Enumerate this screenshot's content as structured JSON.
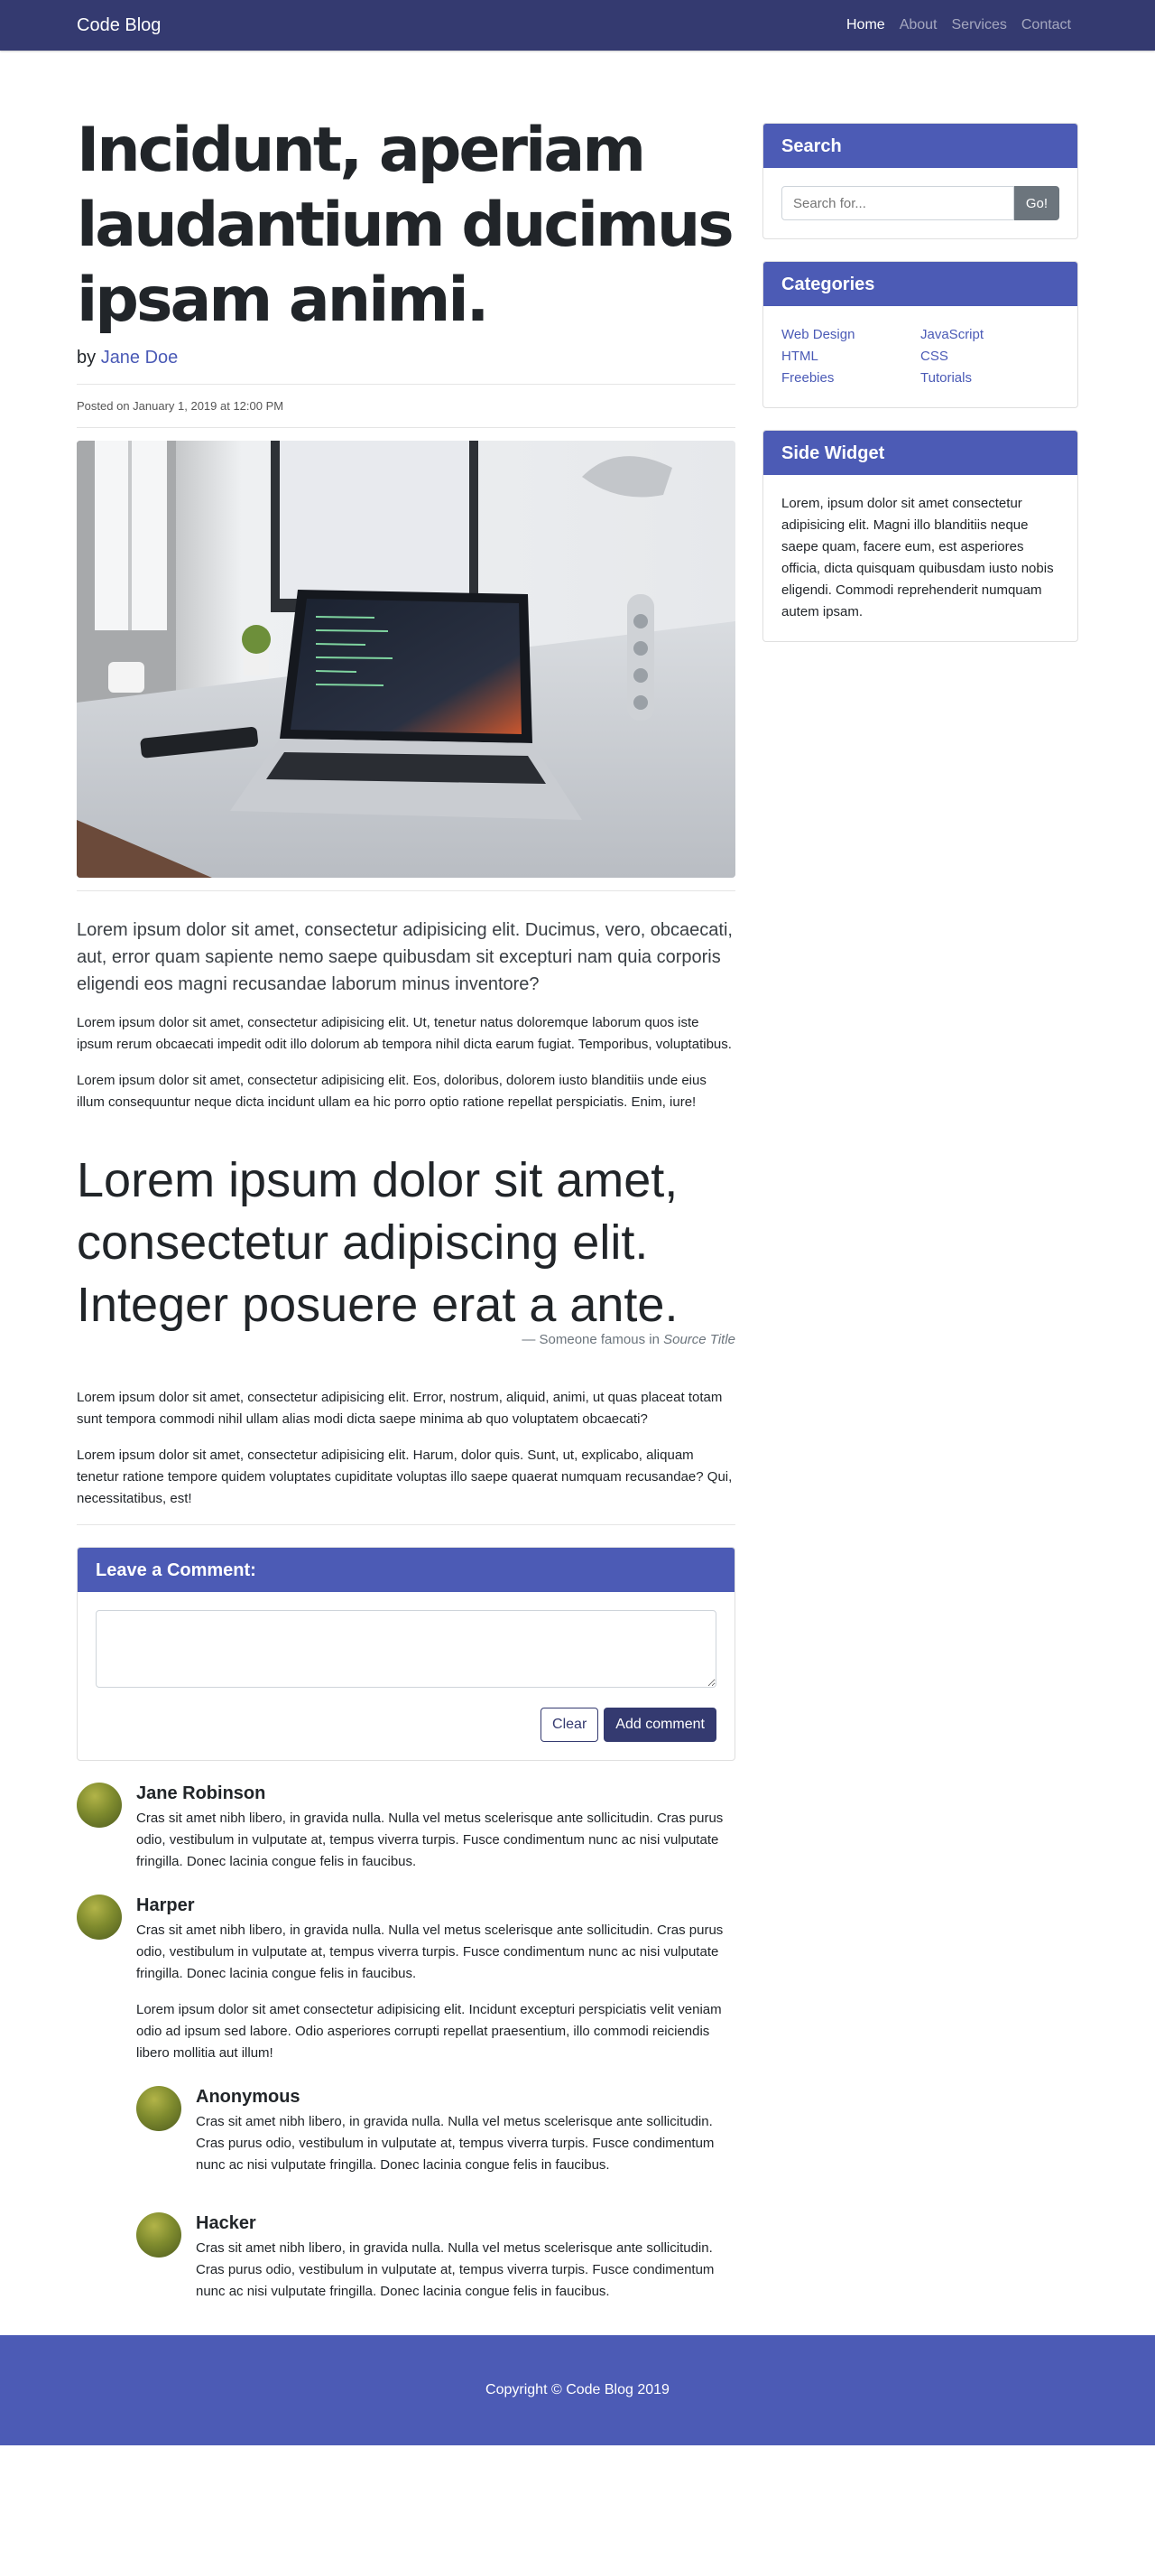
{
  "nav": {
    "brand": "Code Blog",
    "links": [
      {
        "label": "Home",
        "active": true
      },
      {
        "label": "About",
        "active": false
      },
      {
        "label": "Services",
        "active": false
      },
      {
        "label": "Contact",
        "active": false
      }
    ]
  },
  "post": {
    "title": "Incidunt, aperiam laudantium ducimus ipsam animi.",
    "by": "by",
    "author": "Jane Doe",
    "posted": "Posted on January 1, 2019 at 12:00 PM",
    "lead": "Lorem ipsum dolor sit amet, consectetur adipisicing elit. Ducimus, vero, obcaecati, aut, error quam sapiente nemo saepe quibusdam sit excepturi nam quia corporis eligendi eos magni recusandae laborum minus inventore?",
    "p1": "Lorem ipsum dolor sit amet, consectetur adipisicing elit. Ut, tenetur natus doloremque laborum quos iste ipsum rerum obcaecati impedit odit illo dolorum ab tempora nihil dicta earum fugiat. Temporibus, voluptatibus.",
    "p2": "Lorem ipsum dolor sit amet, consectetur adipisicing elit. Eos, doloribus, dolorem iusto blanditiis unde eius illum consequuntur neque dicta incidunt ullam ea hic porro optio ratione repellat perspiciatis. Enim, iure!",
    "quote": "Lorem ipsum dolor sit amet, consectetur adipiscing elit. Integer posuere erat a ante.",
    "quote_attribution": "— Someone famous in",
    "quote_source": "Source Title",
    "p3": "Lorem ipsum dolor sit amet, consectetur adipisicing elit. Error, nostrum, aliquid, animi, ut quas placeat totam sunt tempora commodi nihil ullam alias modi dicta saepe minima ab quo voluptatem obcaecati?",
    "p4": "Lorem ipsum dolor sit amet, consectetur adipisicing elit. Harum, dolor quis. Sunt, ut, explicabo, aliquam tenetur ratione tempore quidem voluptates cupiditate voluptas illo saepe quaerat numquam recusandae? Qui, necessitatibus, est!"
  },
  "comment_form": {
    "title": "Leave a Comment:",
    "clear_label": "Clear",
    "submit_label": "Add comment"
  },
  "comments": [
    {
      "name": "Jane Robinson",
      "text": "Cras sit amet nibh libero, in gravida nulla. Nulla vel metus scelerisque ante sollicitudin. Cras purus odio, vestibulum in vulputate at, tempus viverra turpis. Fusce condimentum nunc ac nisi vulputate fringilla. Donec lacinia congue felis in faucibus."
    },
    {
      "name": "Harper",
      "text": "Cras sit amet nibh libero, in gravida nulla. Nulla vel metus scelerisque ante sollicitudin. Cras purus odio, vestibulum in vulputate at, tempus viverra turpis. Fusce condimentum nunc ac nisi vulputate fringilla. Donec lacinia congue felis in faucibus.",
      "text2": "Lorem ipsum dolor sit amet consectetur adipisicing elit. Incidunt excepturi perspiciatis velit veniam odio ad ipsum sed labore. Odio asperiores corrupti repellat praesentium, illo commodi reiciendis libero mollitia aut illum!",
      "replies": [
        {
          "name": "Anonymous",
          "text": "Cras sit amet nibh libero, in gravida nulla. Nulla vel metus scelerisque ante sollicitudin. Cras purus odio, vestibulum in vulputate at, tempus viverra turpis. Fusce condimentum nunc ac nisi vulputate fringilla. Donec lacinia congue felis in faucibus."
        },
        {
          "name": "Hacker",
          "text": "Cras sit amet nibh libero, in gravida nulla. Nulla vel metus scelerisque ante sollicitudin. Cras purus odio, vestibulum in vulputate at, tempus viverra turpis. Fusce condimentum nunc ac nisi vulputate fringilla. Donec lacinia congue felis in faucibus."
        }
      ]
    }
  ],
  "sidebar": {
    "search": {
      "title": "Search",
      "placeholder": "Search for...",
      "button_label": "Go!"
    },
    "categories": {
      "title": "Categories",
      "col1": [
        "Web Design",
        "HTML",
        "Freebies"
      ],
      "col2": [
        "JavaScript",
        "CSS",
        "Tutorials"
      ]
    },
    "widget": {
      "title": "Side Widget",
      "text": "Lorem, ipsum dolor sit amet consectetur adipisicing elit. Magni illo blanditiis neque saepe quam, facere eum, est asperiores officia, dicta quisquam quibusdam iusto nobis eligendi. Commodi reprehenderit numquam autem ipsam."
    }
  },
  "footer": {
    "text": "Copyright © Code Blog 2019"
  },
  "colors": {
    "navbar": "#343a70",
    "accent": "#4c5bb5",
    "link": "#4a5ab6",
    "secondary_button": "#6c757d"
  },
  "icons": {
    "hero_image": "laptop-desk-photo",
    "avatar": "avatar-image"
  }
}
